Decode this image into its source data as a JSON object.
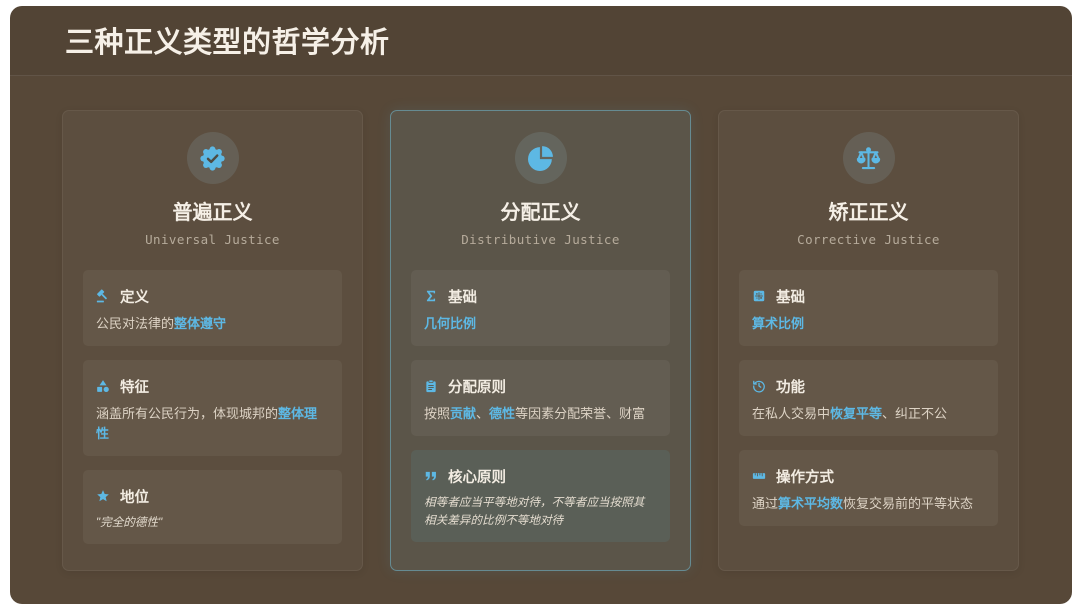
{
  "page": {
    "title": "三种正义类型的哲学分析"
  },
  "colors": {
    "background": "#574838",
    "accent": "#5db8e4",
    "active_card_border": "#6a9aa6",
    "title_text": "#f5efe6"
  },
  "cards": [
    {
      "icon": "badge-check-icon",
      "title": "普遍正义",
      "subtitle": "Universal Justice",
      "active": false,
      "items": [
        {
          "icon": "gavel-icon",
          "label": "定义",
          "segments": [
            {
              "text": "公民对法律的",
              "emphasis": false
            },
            {
              "text": "整体遵守",
              "emphasis": true
            }
          ]
        },
        {
          "icon": "shapes-icon",
          "label": "特征",
          "segments": [
            {
              "text": "涵盖所有公民行为，体现城邦的",
              "emphasis": false
            },
            {
              "text": "整体理性",
              "emphasis": true
            }
          ]
        },
        {
          "icon": "star-icon",
          "label": "地位",
          "italic": true,
          "segments": [
            {
              "text": "\"完全的德性\"",
              "emphasis": false
            }
          ]
        }
      ]
    },
    {
      "icon": "pie-chart-icon",
      "title": "分配正义",
      "subtitle": "Distributive Justice",
      "active": true,
      "items": [
        {
          "icon": "sigma-icon",
          "label": "基础",
          "segments": [
            {
              "text": "几何比例",
              "emphasis": true
            }
          ]
        },
        {
          "icon": "clipboard-icon",
          "label": "分配原则",
          "segments": [
            {
              "text": "按照",
              "emphasis": false
            },
            {
              "text": "贡献",
              "emphasis": true
            },
            {
              "text": "、",
              "emphasis": false
            },
            {
              "text": "德性",
              "emphasis": true
            },
            {
              "text": "等因素分配荣誉、财富",
              "emphasis": false
            }
          ]
        },
        {
          "icon": "quote-icon",
          "label": "核心原则",
          "italic": true,
          "segments": [
            {
              "text": "相等者应当平等地对待，不等者应当按照其相关差异的比例不等地对待",
              "emphasis": false
            }
          ]
        }
      ]
    },
    {
      "icon": "scale-balance-icon",
      "title": "矫正正义",
      "subtitle": "Corrective Justice",
      "active": false,
      "items": [
        {
          "icon": "calculator-icon",
          "label": "基础",
          "segments": [
            {
              "text": "算术比例",
              "emphasis": true
            }
          ]
        },
        {
          "icon": "history-icon",
          "label": "功能",
          "segments": [
            {
              "text": "在私人交易中",
              "emphasis": false
            },
            {
              "text": "恢复平等",
              "emphasis": true
            },
            {
              "text": "、纠正不公",
              "emphasis": false
            }
          ]
        },
        {
          "icon": "ruler-icon",
          "label": "操作方式",
          "segments": [
            {
              "text": "通过",
              "emphasis": false
            },
            {
              "text": "算术平均数",
              "emphasis": true
            },
            {
              "text": "恢复交易前的平等状态",
              "emphasis": false
            }
          ]
        }
      ]
    }
  ]
}
